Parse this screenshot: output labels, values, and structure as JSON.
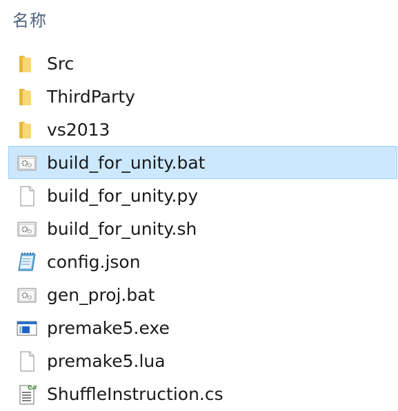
{
  "header": {
    "name_column_label": "名称",
    "sort_indicator": "^"
  },
  "files": [
    {
      "name": "Src",
      "icon": "folder-icon",
      "selected": false
    },
    {
      "name": "ThirdParty",
      "icon": "folder-icon",
      "selected": false
    },
    {
      "name": "vs2013",
      "icon": "folder-icon",
      "selected": false
    },
    {
      "name": "build_for_unity.bat",
      "icon": "batch-file-icon",
      "selected": true
    },
    {
      "name": "build_for_unity.py",
      "icon": "blank-file-icon",
      "selected": false
    },
    {
      "name": "build_for_unity.sh",
      "icon": "batch-file-icon",
      "selected": false
    },
    {
      "name": "config.json",
      "icon": "notepad-file-icon",
      "selected": false
    },
    {
      "name": "gen_proj.bat",
      "icon": "batch-file-icon",
      "selected": false
    },
    {
      "name": "premake5.exe",
      "icon": "executable-file-icon",
      "selected": false
    },
    {
      "name": "premake5.lua",
      "icon": "blank-file-icon",
      "selected": false
    },
    {
      "name": "ShuffleInstruction.cs",
      "icon": "csharp-file-icon",
      "selected": false
    }
  ],
  "colors": {
    "selection_background": "#cce8ff",
    "selection_border": "#99d1ff",
    "folder_yellow": "#f8d775",
    "header_text": "#4c607a"
  }
}
